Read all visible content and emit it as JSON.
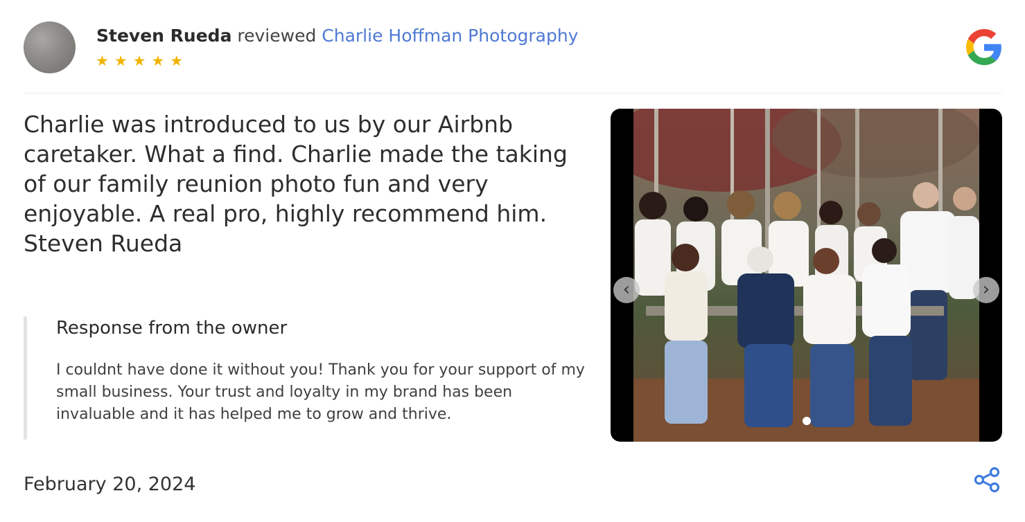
{
  "review": {
    "reviewer_name": "Steven Rueda",
    "reviewed_word": "reviewed",
    "business_name": "Charlie Hoffman Photography",
    "rating": 5,
    "stars": "★★★★★",
    "text": "Charlie was introduced to us by our Airbnb caretaker. What a find. Charlie made the taking of our family reunion photo fun and very enjoyable. A real pro, highly recommend him. Steven Rueda",
    "date": "February 20, 2024"
  },
  "owner_response": {
    "title": "Response from the owner",
    "text": "I couldnt have done it without you! Thank you for your support of my small business. Your trust and loyalty in my brand has been invaluable and it has helped me to grow and thrive."
  },
  "gallery": {
    "prev_label": "‹",
    "next_label": "›",
    "current_index": 1,
    "total": 1
  },
  "icons": {
    "logo": "google-icon",
    "share": "share-icon"
  },
  "colors": {
    "star": "#f0b400",
    "link": "#4f79d3",
    "share": "#3f7be0"
  }
}
